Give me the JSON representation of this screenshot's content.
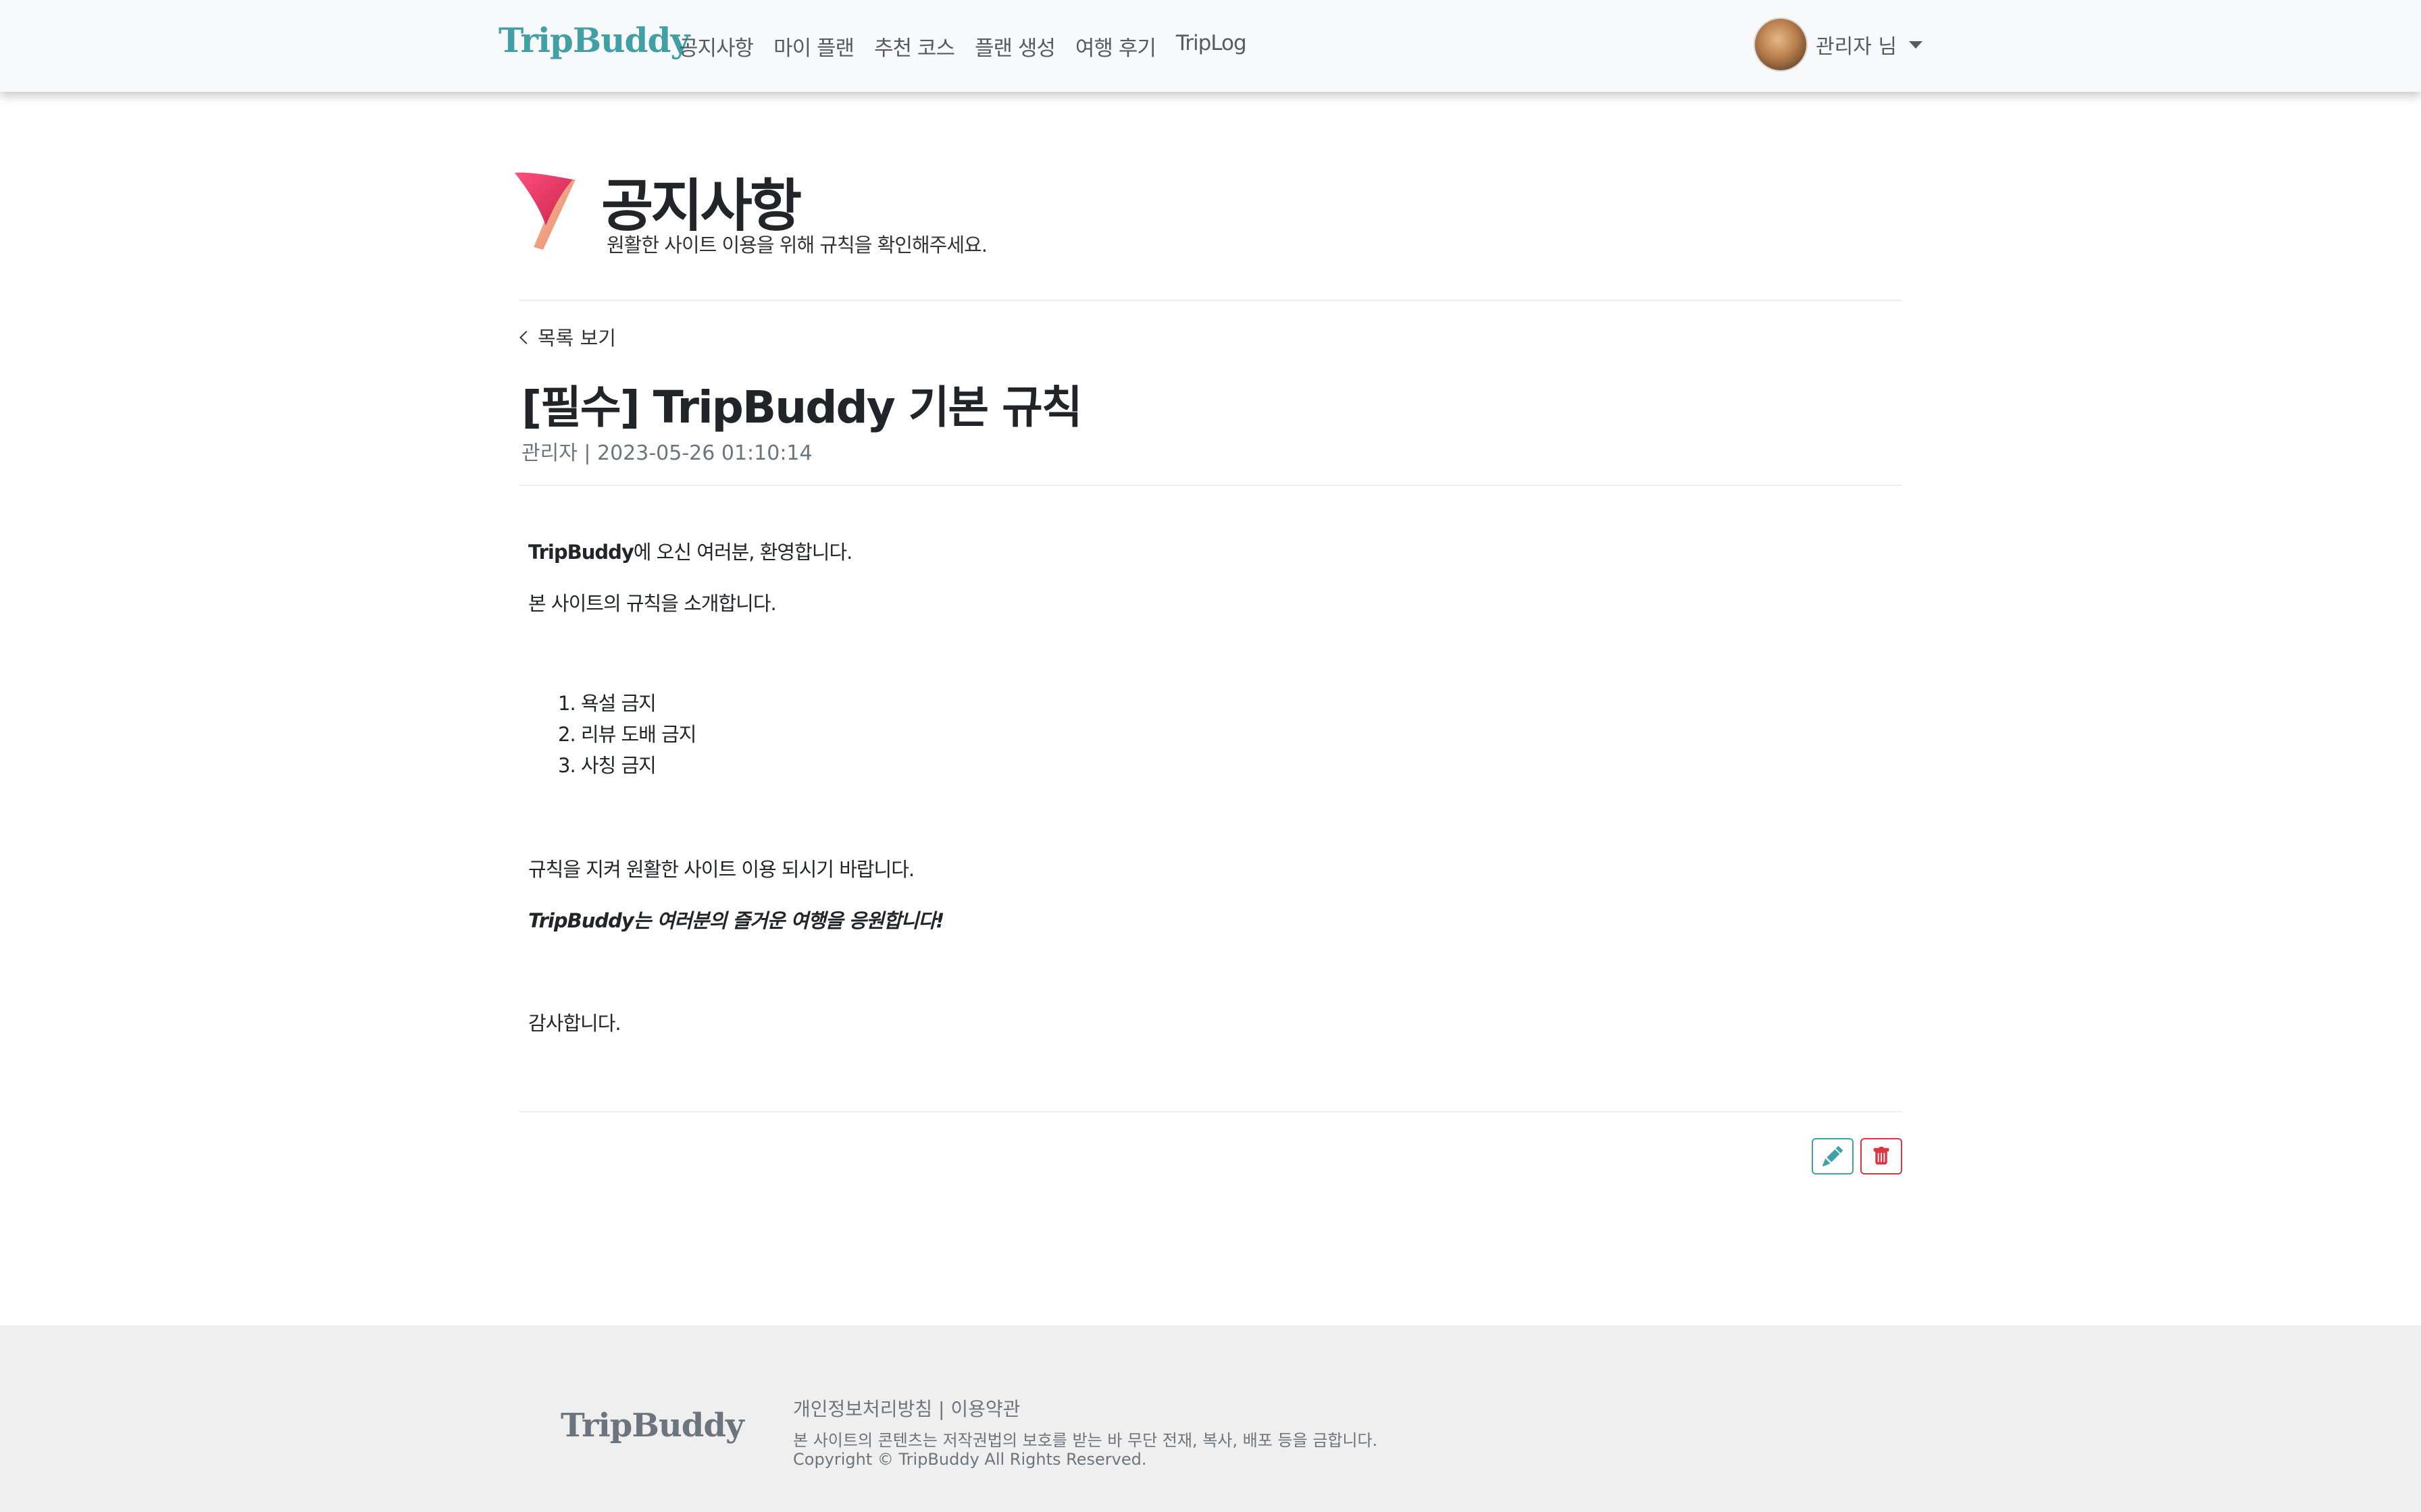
{
  "nav": {
    "brand": "TripBuddy",
    "links": [
      "공지사항",
      "마이 플랜",
      "추천 코스",
      "플랜 생성",
      "여행 후기",
      "TripLog"
    ],
    "user_label": "관리자 님"
  },
  "header": {
    "title": "공지사항",
    "subtitle": "원활한 사이트 이용을 위해 규칙을 확인해주세요."
  },
  "post": {
    "back_label": "목록 보기",
    "title": "[필수] TripBuddy 기본 규칙",
    "meta": "관리자 | 2023-05-26 01:10:14",
    "content": {
      "welcome_brand": "TripBuddy",
      "welcome_rest": "에 오신 여러분, 환영합니다.",
      "intro": "본 사이트의 규칙을 소개합니다.",
      "rules": [
        "1. 욕설 금지",
        "2. 리뷰 도배 금지",
        "3. 사칭 금지"
      ],
      "closing": "규칙을 지켜 원활한 사이트 이용 되시기 바랍니다.",
      "cheer": "TripBuddy는 여러분의 즐거운 여행을 응원합니다!",
      "thanks": "감사합니다."
    }
  },
  "actions": {
    "edit_icon": "pencil-icon",
    "delete_icon": "trash-icon",
    "edit_color": "#41a0a6",
    "delete_color": "#dc3545"
  },
  "footer": {
    "brand": "TripBuddy",
    "privacy": "개인정보처리방침",
    "separator": " | ",
    "terms": "이용약관",
    "notice": "본 사이트의 콘텐츠는 저작권법의 보호를 받는 바 무단 전재, 복사, 배포 등을 금합니다.",
    "copyright": "Copyright © TripBuddy All Rights Reserved."
  },
  "colors": {
    "brand": "#41a0a6",
    "navbar_bg": "#f8f9fa",
    "footer_bg": "#efefef",
    "flag": "#e2456f"
  }
}
